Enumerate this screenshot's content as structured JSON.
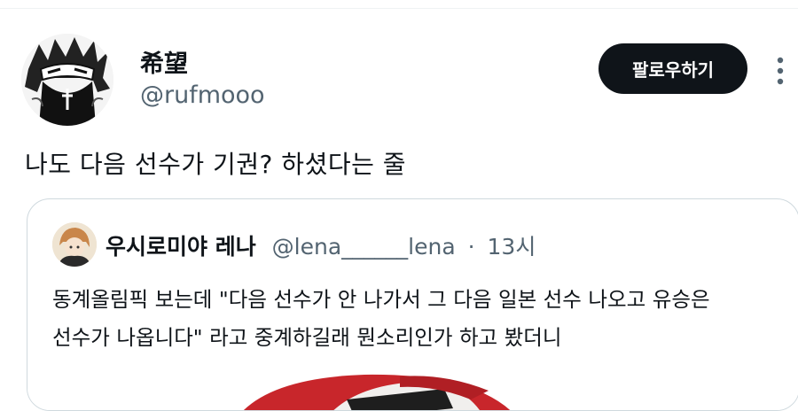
{
  "tweet": {
    "author": {
      "display_name": "希望",
      "handle": "@rufmooo"
    },
    "follow_label": "팔로우하기",
    "more_icon": "more-vertical-icon",
    "text": "나도 다음 선수가 기권? 하셨다는 줄"
  },
  "quote": {
    "author_name": "우시로미야 레나",
    "author_handle": "@lena______lena",
    "separator": "·",
    "time": "13시",
    "body_line1": "동계올림픽 보는데 \"다음 선수가 안 나가서 그 다음 일본 선수 나오고 유승은",
    "body_line2": "선수가 나옵니다\" 라고 중계하길래 뭔소리인가 하고 봤더니"
  }
}
